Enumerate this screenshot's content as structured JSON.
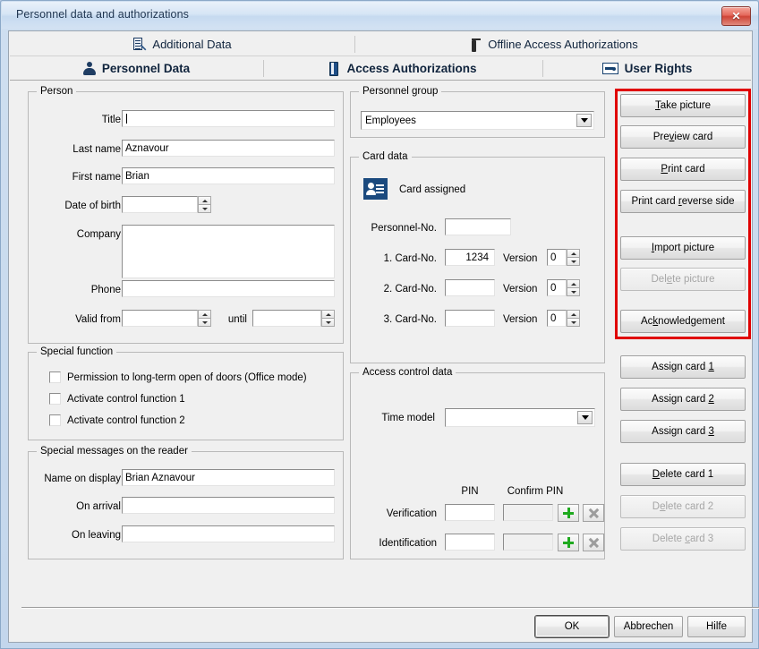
{
  "window": {
    "title": "Personnel data and authorizations",
    "close_label": "✕"
  },
  "tabs": {
    "row1": [
      {
        "label": "Additional Data",
        "icon": "document-icon",
        "active": false
      },
      {
        "label": "Offline Access Authorizations",
        "icon": "key-icon",
        "active": false
      }
    ],
    "row2": [
      {
        "label": "Personnel Data",
        "icon": "person-icon",
        "active": true
      },
      {
        "label": "Access Authorizations",
        "icon": "door-icon",
        "active": false
      },
      {
        "label": "User Rights",
        "icon": "keycard-icon",
        "active": false
      }
    ]
  },
  "person": {
    "legend": "Person",
    "title": {
      "label": "Title",
      "value": ""
    },
    "last_name": {
      "label": "Last name",
      "value": "Aznavour"
    },
    "first_name": {
      "label": "First name",
      "value": "Brian"
    },
    "date_of_birth": {
      "label": "Date of birth",
      "value": ""
    },
    "company": {
      "label": "Company",
      "value": ""
    },
    "phone": {
      "label": "Phone",
      "value": ""
    },
    "valid_from": {
      "label": "Valid from",
      "value": ""
    },
    "until": {
      "label": "until",
      "value": ""
    }
  },
  "special_function": {
    "legend": "Special function",
    "items": [
      {
        "label": "Permission to long-term open of doors (Office mode)",
        "checked": false
      },
      {
        "label": "Activate control function 1",
        "checked": false
      },
      {
        "label": "Activate control function 2",
        "checked": false
      }
    ]
  },
  "special_messages": {
    "legend": "Special messages on the reader",
    "name_on_display": {
      "label": "Name on display",
      "value": "Brian Aznavour"
    },
    "on_arrival": {
      "label": "On arrival",
      "value": ""
    },
    "on_leaving": {
      "label": "On leaving",
      "value": ""
    }
  },
  "personnel_group": {
    "legend": "Personnel group",
    "selected": "Employees"
  },
  "card_data": {
    "legend": "Card data",
    "status": "Card assigned",
    "personnel_no": {
      "label": "Personnel-No.",
      "value": ""
    },
    "version_label": "Version",
    "cards": [
      {
        "label": "1. Card-No.",
        "value": "1234",
        "version": "0"
      },
      {
        "label": "2. Card-No.",
        "value": "",
        "version": "0"
      },
      {
        "label": "3. Card-No.",
        "value": "",
        "version": "0"
      }
    ]
  },
  "access_control": {
    "legend": "Access control data",
    "time_model": {
      "label": "Time model",
      "value": ""
    },
    "pin_header": "PIN",
    "confirm_pin_header": "Confirm PIN",
    "rows": [
      {
        "label": "Verification",
        "pin": "",
        "confirm": ""
      },
      {
        "label": "Identification",
        "pin": "",
        "confirm": ""
      }
    ]
  },
  "picture_actions": {
    "highlighted": true,
    "highlight_color": "#e00000",
    "buttons": [
      {
        "label": "Take picture",
        "accel": "T",
        "disabled": false
      },
      {
        "label": "Preview card",
        "accel": "v",
        "disabled": false
      },
      {
        "label": "Print card",
        "accel": "P",
        "disabled": false
      },
      {
        "label": "Print card reverse side",
        "accel": "r",
        "disabled": false
      },
      {
        "label": "Import picture",
        "accel": "I",
        "disabled": false
      },
      {
        "label": "Delete picture",
        "accel": "e",
        "disabled": true
      },
      {
        "label": "Acknowledgement",
        "accel": "k",
        "disabled": false
      }
    ]
  },
  "card_actions": {
    "buttons": [
      {
        "label": "Assign card 1",
        "accel": "1",
        "disabled": false
      },
      {
        "label": "Assign card 2",
        "accel": "2",
        "disabled": false
      },
      {
        "label": "Assign card 3",
        "accel": "3",
        "disabled": false
      },
      {
        "label": "Delete card 1",
        "accel": "D",
        "disabled": false
      },
      {
        "label": "Delete card 2",
        "accel": "e",
        "disabled": true
      },
      {
        "label": "Delete card 3",
        "accel": "c",
        "disabled": true
      }
    ]
  },
  "footer": {
    "ok": "OK",
    "cancel": "Abbrechen",
    "help": "Hilfe"
  }
}
